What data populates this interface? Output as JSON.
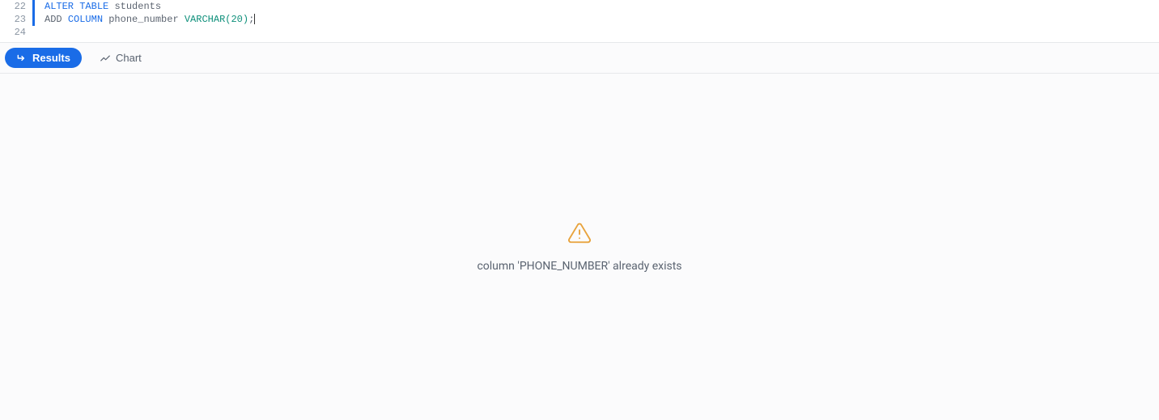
{
  "editor": {
    "lines": [
      {
        "number": "22",
        "hasIndicator": true
      },
      {
        "number": "23",
        "hasIndicator": true
      },
      {
        "number": "24",
        "hasIndicator": false
      }
    ],
    "tokens": {
      "alter": "ALTER",
      "table": "TABLE",
      "students": "students",
      "add": "ADD",
      "column": "COLUMN",
      "phone_number": "phone_number",
      "varchar": "VARCHAR",
      "openParen": "(",
      "twenty": "20",
      "closeParen": ")",
      "semicolon": ";"
    }
  },
  "tabs": {
    "results": "Results",
    "chart": "Chart"
  },
  "results": {
    "errorMessage": "column 'PHONE_NUMBER' already exists"
  }
}
